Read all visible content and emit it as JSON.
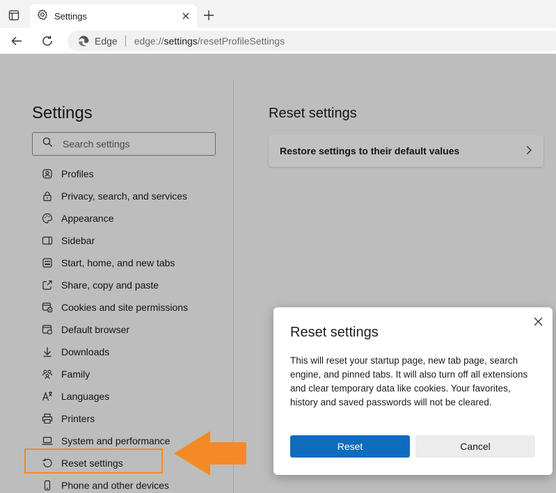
{
  "tab": {
    "title": "Settings"
  },
  "addressbar": {
    "brand": "Edge",
    "url_scheme": "edge://",
    "url_host": "settings",
    "url_path": "/resetProfileSettings"
  },
  "sidebar": {
    "title": "Settings",
    "search_placeholder": "Search settings",
    "items": [
      {
        "label": "Profiles",
        "icon": "profile-icon"
      },
      {
        "label": "Privacy, search, and services",
        "icon": "lock-icon"
      },
      {
        "label": "Appearance",
        "icon": "palette-icon"
      },
      {
        "label": "Sidebar",
        "icon": "sidebar-icon"
      },
      {
        "label": "Start, home, and new tabs",
        "icon": "home-tabs-icon"
      },
      {
        "label": "Share, copy and paste",
        "icon": "share-icon"
      },
      {
        "label": "Cookies and site permissions",
        "icon": "cookies-icon"
      },
      {
        "label": "Default browser",
        "icon": "browser-icon"
      },
      {
        "label": "Downloads",
        "icon": "download-icon"
      },
      {
        "label": "Family",
        "icon": "family-icon"
      },
      {
        "label": "Languages",
        "icon": "languages-icon"
      },
      {
        "label": "Printers",
        "icon": "printer-icon"
      },
      {
        "label": "System and performance",
        "icon": "laptop-icon"
      },
      {
        "label": "Reset settings",
        "icon": "reset-icon"
      },
      {
        "label": "Phone and other devices",
        "icon": "phone-icon"
      }
    ]
  },
  "content": {
    "title": "Reset settings",
    "restore_label": "Restore settings to their default values"
  },
  "dialog": {
    "title": "Reset settings",
    "body": "This will reset your startup page, new tab page, search engine, and pinned tabs. It will also turn off all extensions and clear temporary data like cookies. Your favorites, history and saved passwords will not be cleared.",
    "reset_label": "Reset",
    "cancel_label": "Cancel"
  },
  "colors": {
    "accent": "#0f6cbd",
    "annotation": "#f48a25"
  }
}
